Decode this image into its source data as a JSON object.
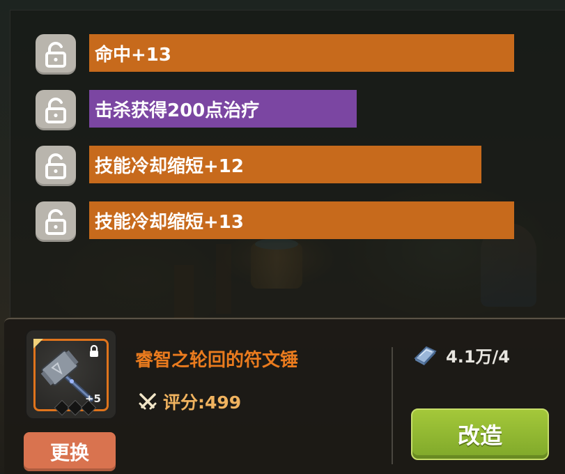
{
  "attributes": [
    {
      "text": "命中+13",
      "color": "orange",
      "locked": false
    },
    {
      "text": "击杀获得200点治疗",
      "color": "purple",
      "locked": false
    },
    {
      "text": "技能冷却缩短+12",
      "color": "orange",
      "locked": false
    },
    {
      "text": "技能冷却缩短+13",
      "color": "orange",
      "locked": false
    }
  ],
  "item": {
    "name": "睿智之轮回的符文锤",
    "level": "+5",
    "score_label": "评分:499",
    "swap_label": "更换",
    "icon": "rune-hammer-icon"
  },
  "cost": {
    "value": "4.1万/4",
    "icon": "reforge-stone-icon"
  },
  "reforge_label": "改造",
  "colors": {
    "orange_bar": "#c76a1c",
    "purple_bar": "#7b46a2",
    "item_name": "#ea7b1e",
    "reforge_button": "#8fb832",
    "swap_button": "#d9734f"
  }
}
